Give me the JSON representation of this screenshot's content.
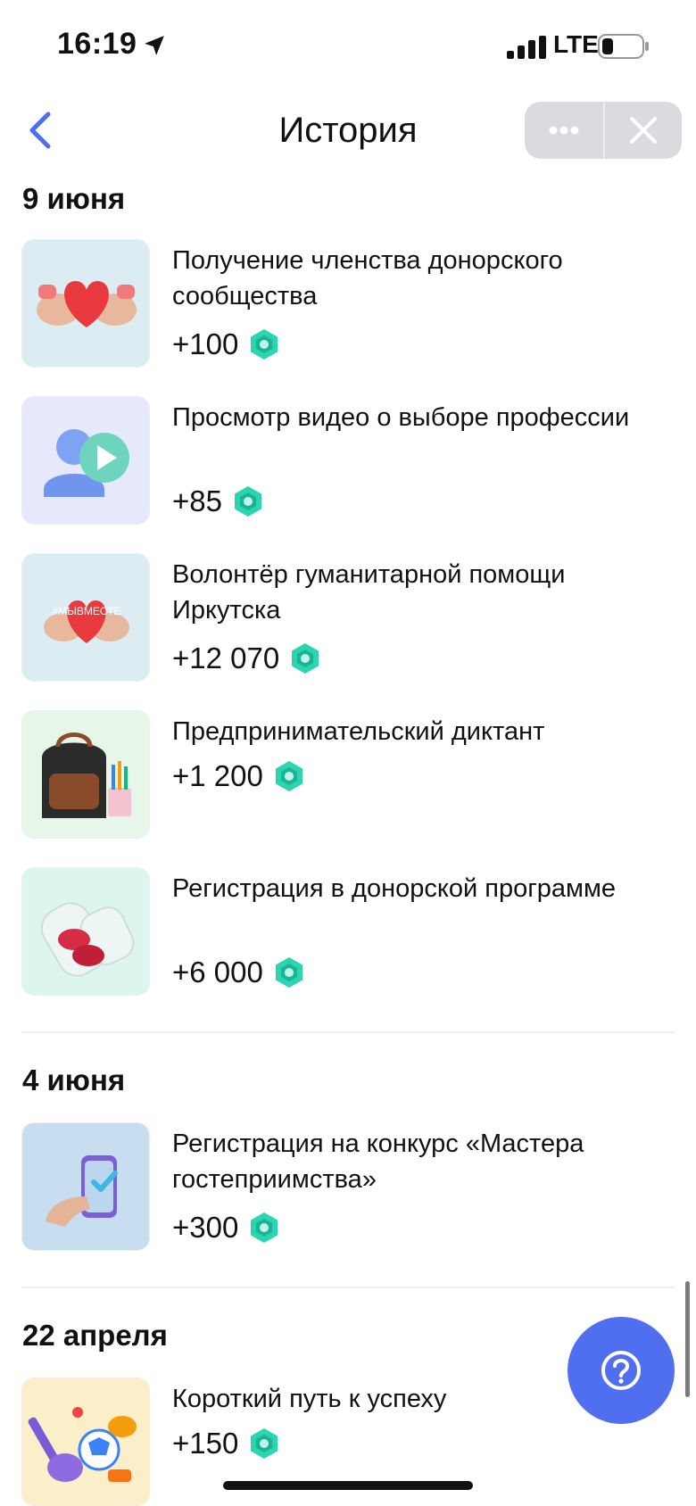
{
  "status_bar": {
    "time": "16:19",
    "network": "LTE",
    "icons": [
      "location-arrow-icon",
      "signal-icon",
      "battery-icon"
    ]
  },
  "nav": {
    "title": "История",
    "back_icon": "chevron-left-icon",
    "more_icon": "more-dots-icon",
    "close_icon": "close-icon"
  },
  "accent_color": "#4f6ff0",
  "coin_color": "#2ad5b0",
  "sections": [
    {
      "date": "9 июня",
      "items": [
        {
          "title": "Получение членства донорского сообщества",
          "points": "+100"
        },
        {
          "title": "Просмотр видео о выборе профессии",
          "points": "+85"
        },
        {
          "title": "Волонтёр гуманитарной помощи Иркутска",
          "points": "+12 070",
          "thumb_text": "#МЫВМЕСТЕ"
        },
        {
          "title": "Предпринимательский диктант",
          "points": "+1 200"
        },
        {
          "title": "Регистрация в донорской программе",
          "points": "+6 000"
        }
      ]
    },
    {
      "date": "4 июня",
      "items": [
        {
          "title": "Регистрация на конкурс «Мастера гостеприимства»",
          "points": "+300"
        }
      ]
    },
    {
      "date": "22 апреля",
      "items": [
        {
          "title": "Короткий путь к успеху",
          "points": "+150"
        }
      ]
    }
  ],
  "help_button_icon": "question-icon"
}
